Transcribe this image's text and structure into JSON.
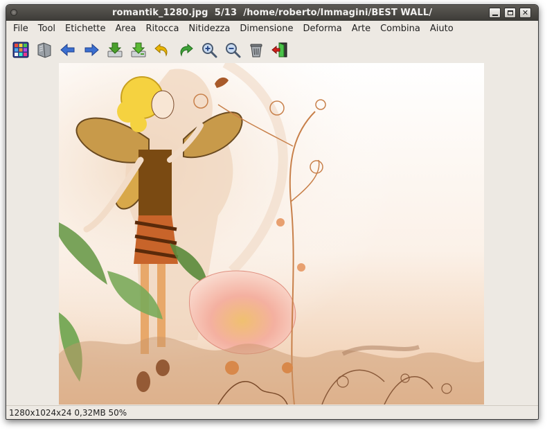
{
  "window": {
    "title": "romantik_1280.jpg  5/13  /home/roberto/Immagini/BEST WALL/"
  },
  "menubar": {
    "items": [
      {
        "label": "File"
      },
      {
        "label": "Tool"
      },
      {
        "label": "Etichette"
      },
      {
        "label": "Area"
      },
      {
        "label": "Ritocca"
      },
      {
        "label": "Nitidezza"
      },
      {
        "label": "Dimensione"
      },
      {
        "label": "Deforma"
      },
      {
        "label": "Arte"
      },
      {
        "label": "Combina"
      },
      {
        "label": "Aiuto"
      }
    ]
  },
  "toolbar": {
    "buttons": [
      {
        "icon": "thumbnail-grid-icon"
      },
      {
        "icon": "open-folder-icon"
      },
      {
        "icon": "arrow-left-icon"
      },
      {
        "icon": "arrow-right-icon"
      },
      {
        "icon": "save-icon"
      },
      {
        "icon": "save-as-icon"
      },
      {
        "icon": "undo-icon"
      },
      {
        "icon": "redo-icon"
      },
      {
        "icon": "zoom-in-icon"
      },
      {
        "icon": "zoom-out-icon"
      },
      {
        "icon": "trash-icon"
      },
      {
        "icon": "exit-icon"
      }
    ]
  },
  "colors": {
    "titlebar": "#3c3b37",
    "window_bg": "#ede9e3",
    "arrow_blue": "#3b6fd0",
    "save_green": "#4aa02c",
    "undo_yellow": "#e8b400",
    "redo_green": "#3fa23a",
    "exit_red": "#d0201a"
  },
  "statusbar": {
    "text": "1280x1024x24 0,32MB 50%"
  }
}
